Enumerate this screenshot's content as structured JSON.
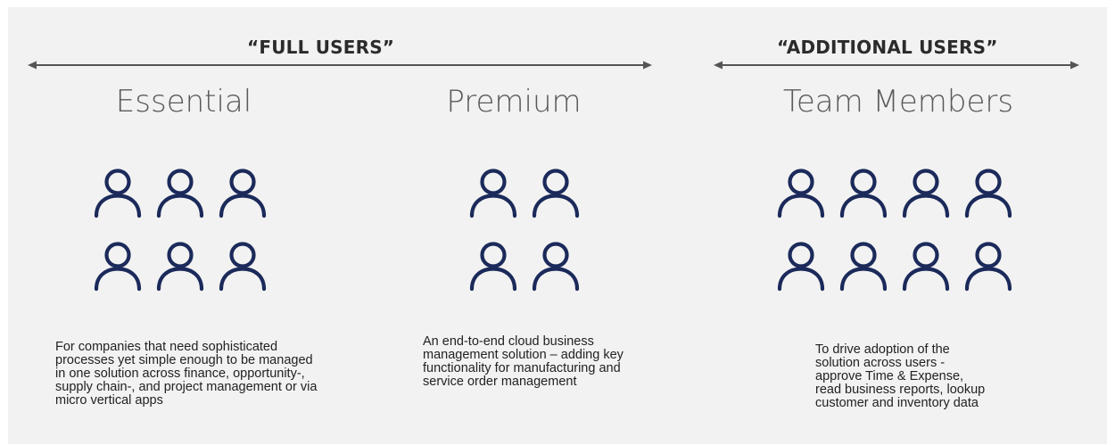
{
  "groups": {
    "full_users": "“FULL USERS”",
    "additional_users": "“ADDITIONAL USERS”"
  },
  "tiers": [
    {
      "title": "Essential",
      "user_icon_count": 6,
      "description": [
        "For companies that need sophisticated",
        "processes yet simple enough to be managed",
        "in one solution across finance, opportunity-,",
        "supply chain-, and project management or via",
        "micro vertical apps"
      ]
    },
    {
      "title": "Premium",
      "user_icon_count": 4,
      "description": [
        "An end-to-end cloud business",
        "management solution – adding key",
        "functionality for manufacturing and",
        "service order management"
      ]
    },
    {
      "title": "Team Members",
      "user_icon_count": 8,
      "description": [
        "To drive adoption of the",
        "solution across users -",
        "approve Time & Expense,",
        "read business reports, lookup",
        "customer and inventory data"
      ]
    }
  ],
  "colors": {
    "icon_stroke": "#1b2a5a",
    "panel_background": "#f2f2f2",
    "arrow": "#555555"
  },
  "icons": {
    "user": "user-outline-icon"
  }
}
